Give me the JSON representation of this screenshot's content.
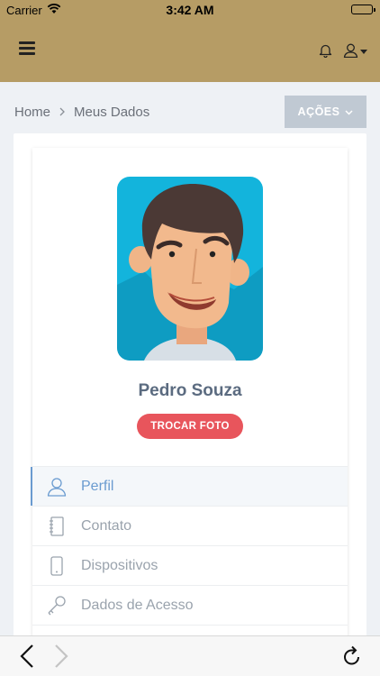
{
  "status_bar": {
    "carrier": "Carrier",
    "time": "3:42 AM"
  },
  "navbar": {
    "menu_icon": "hamburger-icon",
    "notifications_icon": "bell-icon",
    "user_icon": "user-icon"
  },
  "breadcrumb": {
    "home": "Home",
    "current": "Meus Dados"
  },
  "actions": {
    "label": "AÇÕES"
  },
  "profile": {
    "name": "Pedro Souza",
    "change_photo_label": "TROCAR FOTO"
  },
  "menu": {
    "items": [
      {
        "label": "Perfil",
        "icon": "user-icon",
        "active": true
      },
      {
        "label": "Contato",
        "icon": "address-book-icon",
        "active": false
      },
      {
        "label": "Dispositivos",
        "icon": "phone-icon",
        "active": false
      },
      {
        "label": "Dados de Acesso",
        "icon": "key-icon",
        "active": false
      }
    ]
  },
  "colors": {
    "header": "#b69c65",
    "accent": "#6a9bd0",
    "danger": "#e8555c",
    "actions_bg": "#c0c9d3",
    "name": "#5b6b80"
  }
}
